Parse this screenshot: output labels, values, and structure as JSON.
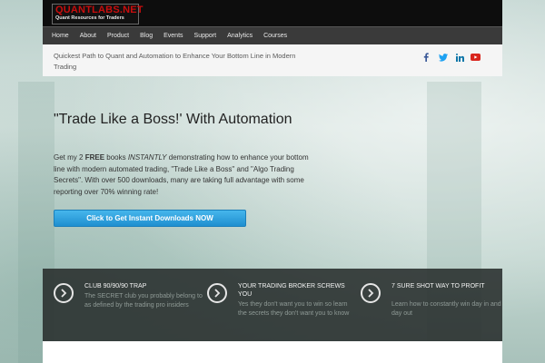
{
  "site": {
    "logo_main": "QUANTLABS.NET",
    "logo_sub": "Quant Resources for Traders"
  },
  "nav": [
    "Home",
    "About",
    "Product",
    "Blog",
    "Events",
    "Support",
    "Analytics",
    "Courses"
  ],
  "tagline": "Quickest Path to Quant and Automation to Enhance Your Bottom Line in Modern Trading",
  "social": [
    {
      "icon": "facebook-icon",
      "glyph": "f",
      "color": "#3b5998"
    },
    {
      "icon": "twitter-icon",
      "glyph": "t",
      "color": "#1da1f2"
    },
    {
      "icon": "linkedin-icon",
      "glyph": "in",
      "color": "#0e76a8"
    },
    {
      "icon": "youtube-icon",
      "glyph": "▶",
      "color": "#d9251d"
    }
  ],
  "hero": {
    "title": "\"Trade Like a Boss!' With Automation",
    "text_1": "Get my 2 ",
    "text_free": "FREE",
    "text_2": " books ",
    "text_instantly": "INSTANTLY",
    "text_3": " demonstrating how to enhance your bottom line with modern automated  trading, \"Trade Like a Boss\" and \"Algo Trading Secrets\".  With over 500 downloads, many are taking full advantage with some reporting over 70% winning rate!",
    "cta": "Click to Get Instant Downloads NOW"
  },
  "features": [
    {
      "title": "CLUB 90/90/90 TRAP",
      "desc": "The SECRET club you probably belong to as defined by the trading pro insiders"
    },
    {
      "title": "YOUR TRADING BROKER SCREWS YOU",
      "desc": "Yes they don't want you to win so learn the secrets they don't want you to know"
    },
    {
      "title": "7 SURE SHOT WAY TO PROFIT",
      "desc": "Learn how to constantly win day in and day out"
    }
  ]
}
